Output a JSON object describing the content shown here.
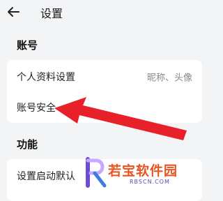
{
  "header": {
    "title": "设置",
    "back_icon": "back-arrow-icon"
  },
  "sections": [
    {
      "title": "账号",
      "items": [
        {
          "label": "个人资料设置",
          "value": "昵称、头像"
        },
        {
          "label": "账号安全",
          "value": ""
        }
      ]
    },
    {
      "title": "功能",
      "items": [
        {
          "label": "设置启动默认",
          "value": ""
        }
      ]
    }
  ],
  "annotation": {
    "icon": "red-pointer-arrow-icon",
    "color": "#e8202a"
  },
  "watermark": {
    "brand": "若宝软件园",
    "url": "RBSCN.COM",
    "logo_color": "#6a4cd6",
    "text_color": "#e8541f"
  }
}
